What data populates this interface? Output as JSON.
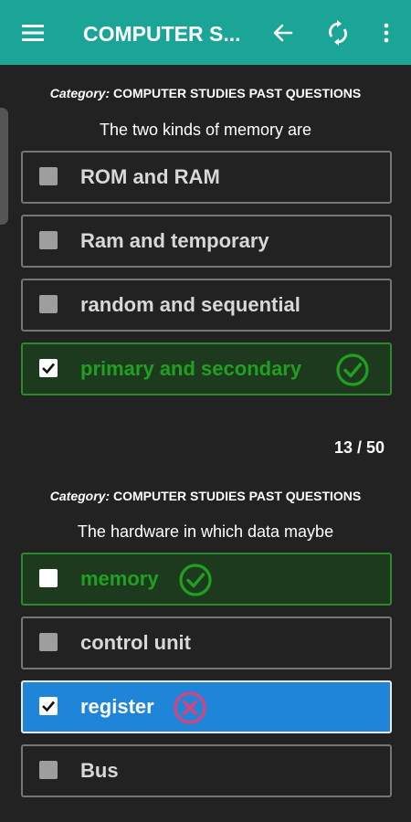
{
  "appbar": {
    "title": "COMPUTER S...",
    "menu_icon": "hamburger-menu-icon",
    "back_icon": "arrow-left-icon",
    "refresh_icon": "refresh-icon",
    "more_icon": "more-vertical-icon",
    "color": "#1aa596"
  },
  "questions": [
    {
      "category_label": "Category:",
      "category_value": "COMPUTER STUDIES PAST QUESTIONS",
      "text": "The two kinds of memory are",
      "options": [
        {
          "label": "ROM and RAM",
          "state": "unchecked"
        },
        {
          "label": "Ram and temporary",
          "state": "unchecked"
        },
        {
          "label": "random and sequential",
          "state": "unchecked"
        },
        {
          "label": "primary and secondary",
          "state": "correct-checked"
        }
      ]
    },
    {
      "category_label": "Category:",
      "category_value": "COMPUTER STUDIES PAST QUESTIONS",
      "text": "The hardware in which data maybe",
      "options": [
        {
          "label": "memory",
          "state": "correct-unchecked"
        },
        {
          "label": "control unit",
          "state": "unchecked"
        },
        {
          "label": "register",
          "state": "wrong-checked"
        },
        {
          "label": "Bus",
          "state": "unchecked"
        }
      ]
    }
  ],
  "counter": "13 / 50",
  "colors": {
    "background": "#222222",
    "correct_text": "#20a020",
    "correct_bg": "#1e3a1e",
    "selected_bg": "#1e85d8",
    "wrong_icon": "#e0407a"
  }
}
